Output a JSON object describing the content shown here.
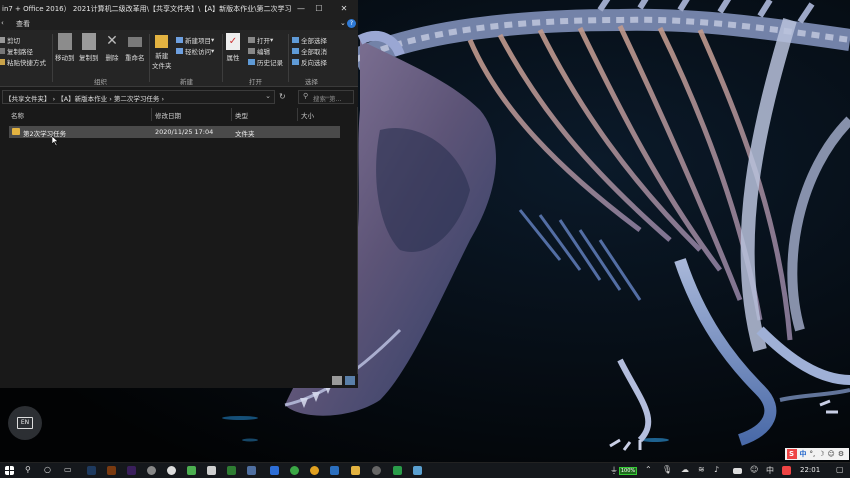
{
  "window": {
    "title": "in7 + Office 2016） 2021计算机二级改革用\\【共享文件夹】\\【A】新版本作业\\第二次学习...",
    "minimize": "—",
    "maximize": "☐",
    "close": "✕"
  },
  "ribbon": {
    "tab_view": "查看",
    "help": "?",
    "clipboard": {
      "cut": "剪切",
      "copy_path": "复制路径",
      "paste_shortcut": "粘贴快捷方式"
    },
    "organize": {
      "move_to": "移动到",
      "copy_to": "复制到",
      "delete": "删除",
      "rename": "重命名",
      "group": "组织"
    },
    "new": {
      "new_folder_1": "新建",
      "new_folder_2": "文件夹",
      "new_item": "新建项目",
      "easy_access": "轻松访问",
      "group": "新建"
    },
    "open": {
      "properties": "属性",
      "open": "打开",
      "edit": "编辑",
      "history": "历史记录",
      "group": "打开"
    },
    "select": {
      "select_all": "全部选择",
      "select_none": "全部取消",
      "invert": "反向选择",
      "group": "选择"
    }
  },
  "address": {
    "path": "【共享文件夹】 › 【A】新版本作业 › 第二次学习任务 ›",
    "search_placeholder": "搜索\"第..."
  },
  "columns": {
    "name": "名称",
    "modified": "修改日期",
    "type": "类型",
    "size": "大小"
  },
  "files": [
    {
      "name": "第2次学习任务",
      "modified": "2020/11/25 17:04",
      "type": "文件夹",
      "size": ""
    }
  ],
  "language_badge": "EN",
  "ime": {
    "logo": "S",
    "mode": "中",
    "punct": "°,",
    "moon": "☽",
    "smile": "☺",
    "gear": "⚙"
  },
  "taskbar": {
    "battery": "100%",
    "clock": "22:01"
  }
}
